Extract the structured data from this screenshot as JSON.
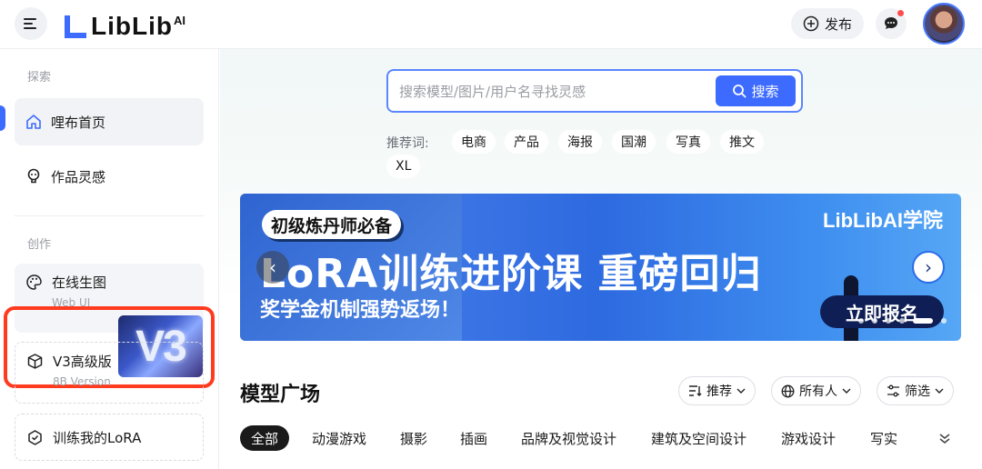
{
  "header": {
    "logo": "LibLib",
    "logo_sup": "AI",
    "publish_label": "发布"
  },
  "sidebar": {
    "explore_title": "探索",
    "items": [
      {
        "label": "哩布首页"
      },
      {
        "label": "作品灵感"
      }
    ],
    "create_title": "创作",
    "cards": [
      {
        "label": "在线生图",
        "sub": "Web UI",
        "badge": "V3"
      },
      {
        "label": "V3高级版",
        "sub": "8B Version"
      },
      {
        "label": "训练我的LoRA"
      }
    ]
  },
  "search": {
    "placeholder": "搜索模型/图片/用户名寻找灵感",
    "button_label": "搜索",
    "tags_label": "推荐词:",
    "tags": [
      "电商",
      "产品",
      "海报",
      "国潮",
      "写真",
      "推文",
      "XL"
    ]
  },
  "banner": {
    "pill": "初级炼丹师必备",
    "logo": "LibLibAI学院",
    "title": "LoRA训练进阶课 重磅回归",
    "subtitle": "奖学金机制强势返场！",
    "cta": "立即报名"
  },
  "models": {
    "title": "模型广场",
    "filters": [
      "推荐",
      "所有人",
      "筛选"
    ],
    "categories": [
      "全部",
      "动漫游戏",
      "摄影",
      "插画",
      "品牌及视觉设计",
      "建筑及空间设计",
      "游戏设计",
      "写实"
    ]
  },
  "colors": {
    "accent": "#3d6bff",
    "highlight_frame": "#ff3b1f"
  }
}
